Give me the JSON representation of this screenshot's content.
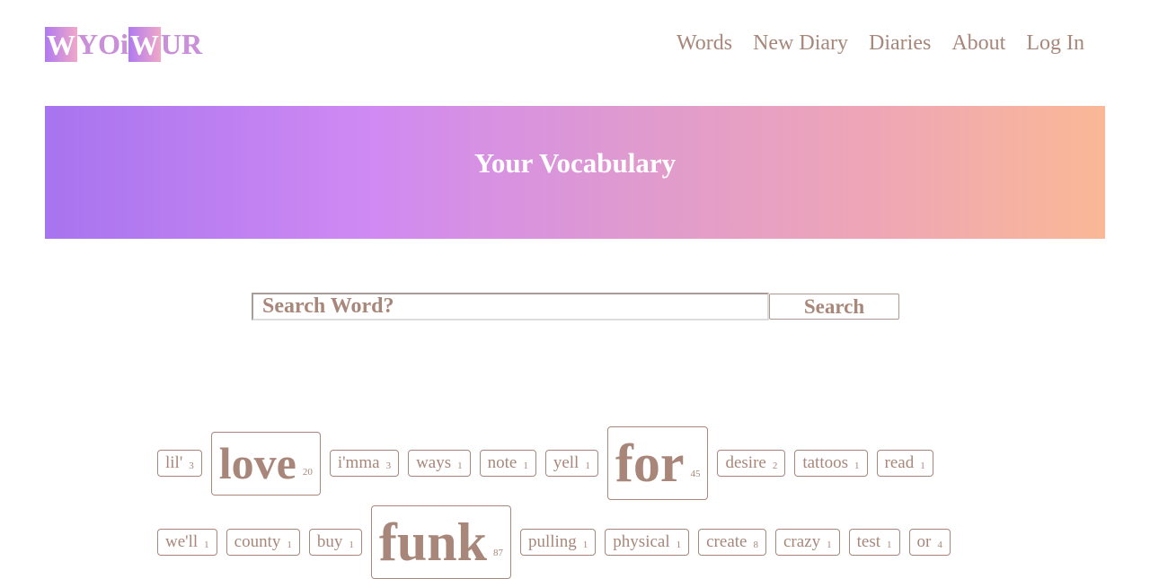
{
  "logo": {
    "parts": [
      "W",
      "YOi",
      "W",
      "UR"
    ]
  },
  "nav": [
    "Words",
    "New Diary",
    "Diaries",
    "About",
    "Log In"
  ],
  "banner": {
    "title": "Your Vocabulary"
  },
  "search": {
    "placeholder": "Search Word?",
    "value": "",
    "button_label": "Search"
  },
  "words": {
    "row1": [
      {
        "word": "lil'",
        "count": "3",
        "size": "s"
      },
      {
        "word": "love",
        "count": "20",
        "size": "l"
      },
      {
        "word": "i'mma",
        "count": "3",
        "size": "s"
      },
      {
        "word": "ways",
        "count": "1",
        "size": "s"
      },
      {
        "word": "note",
        "count": "1",
        "size": "s"
      },
      {
        "word": "yell",
        "count": "1",
        "size": "s"
      },
      {
        "word": "for",
        "count": "45",
        "size": "l"
      },
      {
        "word": "desire",
        "count": "2",
        "size": "s"
      },
      {
        "word": "tattoos",
        "count": "1",
        "size": "s"
      },
      {
        "word": "read",
        "count": "1",
        "size": "s"
      }
    ],
    "row2": [
      {
        "word": "we'll",
        "count": "1",
        "size": "s"
      },
      {
        "word": "county",
        "count": "1",
        "size": "s"
      },
      {
        "word": "buy",
        "count": "1",
        "size": "s"
      },
      {
        "word": "funk",
        "count": "87",
        "size": "l"
      },
      {
        "word": "pulling",
        "count": "1",
        "size": "s"
      },
      {
        "word": "physical",
        "count": "1",
        "size": "s"
      },
      {
        "word": "create",
        "count": "8",
        "size": "s"
      },
      {
        "word": "crazy",
        "count": "1",
        "size": "s"
      },
      {
        "word": "test",
        "count": "1",
        "size": "s"
      },
      {
        "word": "or",
        "count": "4",
        "size": "s"
      }
    ]
  }
}
